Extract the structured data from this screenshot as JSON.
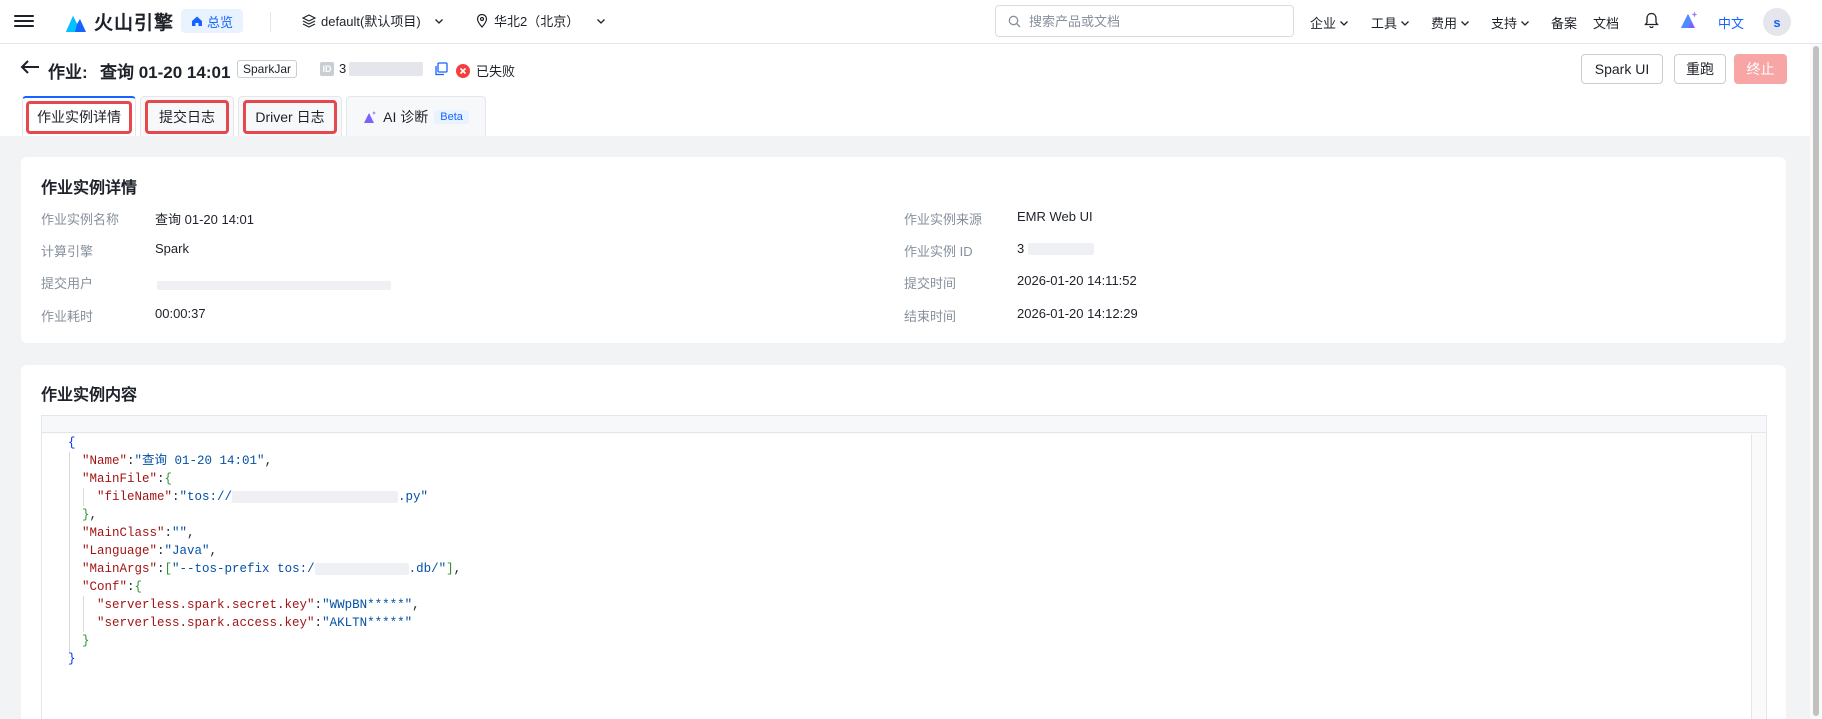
{
  "topbar": {
    "brand": "火山引擎",
    "home_label": "总览",
    "project": "default(默认项目)",
    "region": "华北2（北京）",
    "search_placeholder": "搜索产品或文档",
    "nav": [
      "企业",
      "工具",
      "费用",
      "支持",
      "备案",
      "文档"
    ],
    "language": "中文",
    "avatar_initial": "s"
  },
  "header": {
    "title_prefix": "作业:",
    "title": "查询 01-20 14:01",
    "job_type": "SparkJar",
    "id_prefix": "3",
    "status": "已失败",
    "buttons": {
      "spark_ui": "Spark UI",
      "rerun": "重跑",
      "stop": "终止"
    }
  },
  "tabs": [
    {
      "label": "作业实例详情",
      "active": true
    },
    {
      "label": "提交日志",
      "active": false
    },
    {
      "label": "Driver 日志",
      "active": false
    },
    {
      "label": "AI 诊断",
      "badge": "Beta",
      "active": false
    }
  ],
  "details": {
    "title": "作业实例详情",
    "left": [
      {
        "label": "作业实例名称",
        "value": "查询 01-20 14:01"
      },
      {
        "label": "计算引擎",
        "value": "Spark"
      },
      {
        "label": "提交用户",
        "value": ""
      },
      {
        "label": "作业耗时",
        "value": "00:00:37"
      }
    ],
    "right": [
      {
        "label": "作业实例来源",
        "value": "EMR Web UI"
      },
      {
        "label": "作业实例 ID",
        "value": "3"
      },
      {
        "label": "提交时间",
        "value": "2026-01-20 14:11:52"
      },
      {
        "label": "结束时间",
        "value": "2026-01-20 14:12:29"
      }
    ]
  },
  "content": {
    "title": "作业实例内容",
    "code": {
      "open": "{",
      "name_key": "\"Name\"",
      "name_val": "\"查询 01-20 14:01\"",
      "mainfile_key": "\"MainFile\"",
      "filename_key": "\"fileName\"",
      "filename_val_start": "\"tos://",
      "filename_val_end": ".py\"",
      "mainclass_key": "\"MainClass\"",
      "mainclass_val": "\"\"",
      "language_key": "\"Language\"",
      "language_val": "\"Java\"",
      "mainargs_key": "\"MainArgs\"",
      "mainargs_val_start": "\"--tos-prefix tos:/",
      "mainargs_val_end": ".db/\"",
      "conf_key": "\"Conf\"",
      "secret_key": "\"serverless.spark.secret.key\"",
      "secret_val": "\"WWpBN*****\"",
      "access_key": "\"serverless.spark.access.key\"",
      "access_val": "\"AKLTN*****\"",
      "close": "}"
    }
  }
}
